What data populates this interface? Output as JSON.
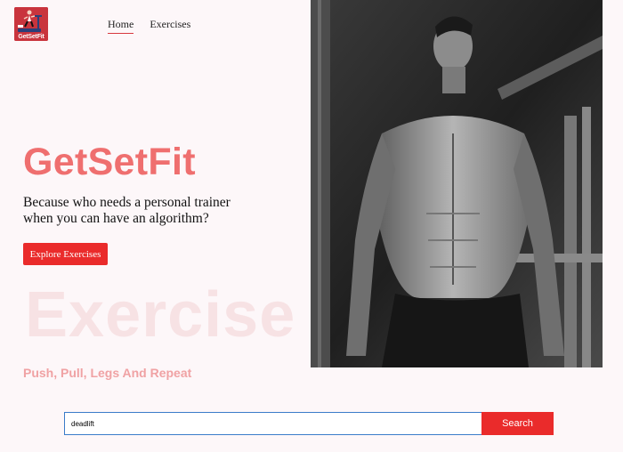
{
  "brand": {
    "logo_text": "GetSetFit",
    "logo_icon": "treadmill-runner-icon",
    "accent_color": "#ea2b2b",
    "title_color": "#ef6f6f"
  },
  "nav": {
    "items": [
      {
        "label": "Home",
        "active": true
      },
      {
        "label": "Exercises",
        "active": false
      }
    ]
  },
  "hero": {
    "title": "GetSetFit",
    "subtitle": "Because who needs a personal trainer when you can have an algorithm?",
    "cta_label": "Explore Exercises",
    "background_word": "Exercise",
    "tagline": "Push, Pull, Legs And Repeat",
    "image_description": "black-and-white photo of shirtless athlete in gym"
  },
  "search": {
    "value": "deadlift",
    "button_label": "Search"
  }
}
